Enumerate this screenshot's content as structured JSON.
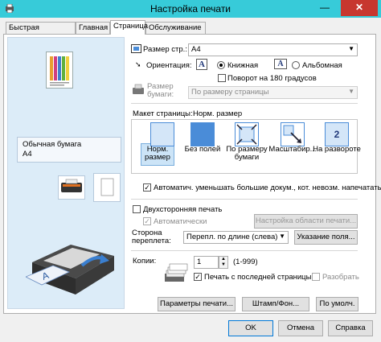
{
  "window": {
    "title": "Настройка печати",
    "minimize": "—",
    "close": "✕"
  },
  "tabs": [
    "Быстрая установка",
    "Главная",
    "Страница",
    "Обслуживание"
  ],
  "left_panel": {
    "media_type": "Обычная бумага",
    "paper_size": "A4"
  },
  "page_size": {
    "label": "Размер стр.:",
    "value": "A4"
  },
  "orientation": {
    "label": "Ориентация:",
    "portrait": "Книжная",
    "landscape": "Альбомная",
    "rotate180": "Поворот на 180 градусов",
    "icon_letter": "A"
  },
  "paper_size": {
    "label_line1": "Размер",
    "label_line2": "бумаги:",
    "value": "По размеру страницы"
  },
  "page_layout": {
    "label": "Макет страницы:",
    "value": "Норм. размер",
    "options": [
      {
        "label": "Норм. размер",
        "selected": true
      },
      {
        "label": "Без полей",
        "selected": false
      },
      {
        "label": "По размеру бумаги",
        "selected": false
      },
      {
        "label": "Масштабир...",
        "selected": false
      },
      {
        "label": "На развороте",
        "selected": false
      }
    ],
    "spread_number": "2"
  },
  "auto_reduce": {
    "label": "Автоматич. уменьшать большие докум., кот. невозм. напечатать",
    "checked": true
  },
  "duplex": {
    "label": "Двухсторонняя печать",
    "auto_label": "Автоматически",
    "area_button": "Настройка области печати...",
    "binding_label_line1": "Сторона",
    "binding_label_line2": "переплета:",
    "binding_value": "Перепл. по длине (слева)",
    "margin_button": "Указание поля..."
  },
  "copies": {
    "label": "Копии:",
    "value": "1",
    "range": "(1-999)",
    "from_last_label": "Печать с последней страницы",
    "collate_label": "Разобрать"
  },
  "bottom_buttons": {
    "print_options": "Параметры печати...",
    "stamp": "Штамп/Фон...",
    "defaults": "По умолч."
  },
  "dialog_buttons": {
    "ok": "OK",
    "cancel": "Отмена",
    "help": "Справка"
  },
  "colors": {
    "titlebar": "#37cbd9",
    "close": "#c7372f",
    "selection": "#cce4f7",
    "accent": "#4a8cd8"
  }
}
